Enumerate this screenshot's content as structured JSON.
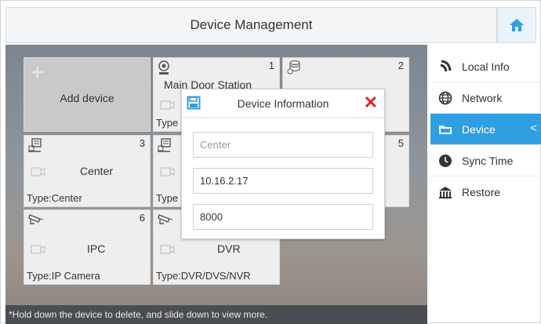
{
  "header": {
    "title": "Device Management",
    "home_icon": "home-icon",
    "accent": "#2f9fe2"
  },
  "add_tile": {
    "label": "Add device",
    "icon": "plus-icon"
  },
  "devices": [
    {
      "num": "1",
      "name": "Main Door Station",
      "type": "Type",
      "icon": "door-station-icon"
    },
    {
      "num": "2",
      "name": "",
      "type": "",
      "icon": "database-icon"
    },
    {
      "num": "3",
      "name": "Center",
      "type": "Type:Center",
      "icon": "monitor-icon"
    },
    {
      "num": "",
      "name": "",
      "type": "Type",
      "icon": "monitor-icon"
    },
    {
      "num": "5",
      "name": "",
      "type": "",
      "icon": ""
    },
    {
      "num": "6",
      "name": "IPC",
      "type": "Type:IP Camera",
      "icon": "ip-camera-icon"
    },
    {
      "num": "",
      "name": "DVR",
      "type": "Type:DVR/DVS/NVR",
      "icon": "ip-camera-icon"
    }
  ],
  "dialog": {
    "title": "Device Information",
    "fields": [
      {
        "value": "",
        "placeholder": "Center"
      },
      {
        "value": "10.16.2.17",
        "placeholder": ""
      },
      {
        "value": "8000",
        "placeholder": ""
      }
    ]
  },
  "footer": {
    "hint": "*Hold down the device to delete, and slide down to view more."
  },
  "sidebar": {
    "items": [
      {
        "label": "Local Info",
        "icon": "local-info-icon",
        "active": false
      },
      {
        "label": "Network",
        "icon": "globe-icon",
        "active": true
      },
      {
        "label": "Device",
        "icon": "device-folder-icon",
        "active": true
      },
      {
        "label": "Sync Time",
        "icon": "clock-icon",
        "active": false
      },
      {
        "label": "Restore",
        "icon": "restore-icon",
        "active": false
      }
    ],
    "active_chevron": "<"
  }
}
